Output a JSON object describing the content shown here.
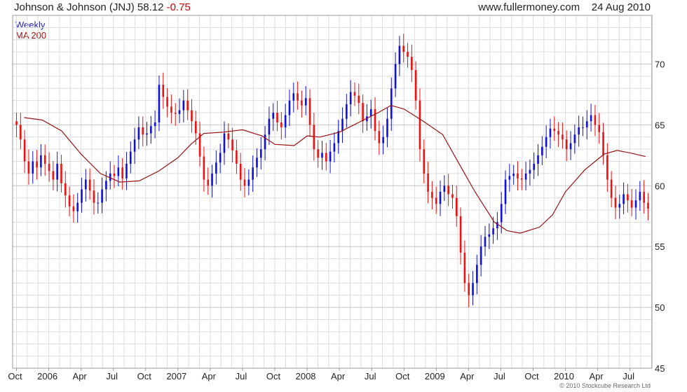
{
  "header": {
    "title": "Johnson & Johnson (JNJ) 58.12",
    "change": "-0.75",
    "site": "www.fullermoney.com",
    "date": "24 Aug 2010"
  },
  "legend": {
    "period": "Weekly",
    "ma": "MA 200"
  },
  "footer": "© 2010 Stockcube Research Ltd",
  "colors": {
    "up": "#1010dd",
    "down": "#ee1111",
    "ma": "#9a1010",
    "grid": "#dcdcdc"
  },
  "chart_data": {
    "type": "line",
    "subtype": "weekly price bars (up weeks blue, down weeks red) with 200-period moving average",
    "ylim": [
      45,
      74
    ],
    "yticks": [
      45,
      50,
      55,
      60,
      65,
      70
    ],
    "grid": true,
    "y_axis_side": "right",
    "xticks": [
      "Oct",
      "2006",
      "Apr",
      "Jul",
      "Oct",
      "2007",
      "Apr",
      "Jul",
      "Oct",
      "2008",
      "Apr",
      "Jul",
      "Oct",
      "2009",
      "Apr",
      "Jul",
      "Oct",
      "2010",
      "Apr",
      "Jul"
    ],
    "price_closes": [
      65.0,
      63.8,
      62.0,
      61.0,
      62.0,
      61.5,
      62.5,
      61.8,
      61.2,
      60.5,
      61.8,
      60.2,
      59.2,
      58.3,
      57.9,
      58.6,
      59.7,
      60.5,
      59.6,
      58.6,
      58.6,
      59.7,
      60.4,
      61.0,
      60.8,
      61.5,
      60.6,
      61.8,
      62.8,
      63.8,
      64.8,
      64.2,
      64.3,
      64.9,
      65.2,
      68.3,
      67.3,
      66.5,
      66.0,
      65.9,
      66.2,
      67.0,
      66.2,
      65.3,
      64.3,
      62.4,
      60.5,
      60.0,
      61.0,
      61.9,
      62.7,
      64.3,
      63.8,
      62.9,
      61.8,
      60.5,
      60.0,
      60.5,
      61.5,
      62.3,
      63.0,
      64.2,
      65.5,
      66.0,
      65.2,
      64.8,
      65.8,
      67.0,
      67.6,
      67.0,
      66.6,
      67.2,
      65.0,
      63.0,
      62.3,
      62.7,
      62.0,
      62.8,
      63.5,
      64.5,
      65.5,
      66.7,
      67.7,
      67.4,
      66.8,
      65.3,
      65.7,
      66.3,
      64.5,
      63.5,
      64.0,
      65.5,
      68.0,
      70.0,
      71.5,
      71.0,
      70.6,
      69.5,
      67.0,
      63.0,
      61.0,
      59.5,
      59.0,
      58.5,
      59.5,
      60.0,
      59.3,
      59.0,
      57.5,
      54.5,
      52.0,
      51.0,
      52.0,
      53.5,
      55.0,
      55.8,
      56.0,
      56.5,
      57.0,
      58.5,
      60.5,
      60.8,
      61.0,
      60.6,
      60.5,
      61.0,
      61.3,
      61.8,
      62.5,
      63.2,
      64.0,
      64.7,
      64.5,
      64.2,
      63.8,
      63.0,
      63.5,
      64.2,
      64.8,
      64.8,
      65.3,
      65.8,
      65.0,
      64.4,
      62.5,
      60.5,
      59.0,
      58.2,
      58.5,
      59.3,
      58.8,
      58.2,
      58.8,
      59.5,
      58.6,
      58.12
    ],
    "ma200": [
      [
        2005.81,
        65.6
      ],
      [
        2005.95,
        65.4
      ],
      [
        2006.1,
        64.5
      ],
      [
        2006.25,
        62.6
      ],
      [
        2006.4,
        61.0
      ],
      [
        2006.55,
        60.3
      ],
      [
        2006.7,
        60.4
      ],
      [
        2006.85,
        61.2
      ],
      [
        2007.0,
        62.3
      ],
      [
        2007.1,
        63.4
      ],
      [
        2007.2,
        64.3
      ],
      [
        2007.35,
        64.4
      ],
      [
        2007.5,
        64.6
      ],
      [
        2007.65,
        64.1
      ],
      [
        2007.75,
        63.4
      ],
      [
        2007.9,
        63.3
      ],
      [
        2008.0,
        64.1
      ],
      [
        2008.1,
        64.0
      ],
      [
        2008.25,
        64.4
      ],
      [
        2008.4,
        65.2
      ],
      [
        2008.55,
        66.0
      ],
      [
        2008.65,
        66.6
      ],
      [
        2008.75,
        66.3
      ],
      [
        2008.9,
        65.3
      ],
      [
        2009.05,
        64.2
      ],
      [
        2009.15,
        62.3
      ],
      [
        2009.3,
        59.5
      ],
      [
        2009.45,
        57.0
      ],
      [
        2009.55,
        56.3
      ],
      [
        2009.65,
        56.1
      ],
      [
        2009.8,
        56.6
      ],
      [
        2009.9,
        57.6
      ],
      [
        2010.0,
        59.5
      ],
      [
        2010.15,
        61.3
      ],
      [
        2010.3,
        62.6
      ],
      [
        2010.4,
        62.9
      ],
      [
        2010.5,
        62.7
      ],
      [
        2010.62,
        62.4
      ]
    ]
  }
}
